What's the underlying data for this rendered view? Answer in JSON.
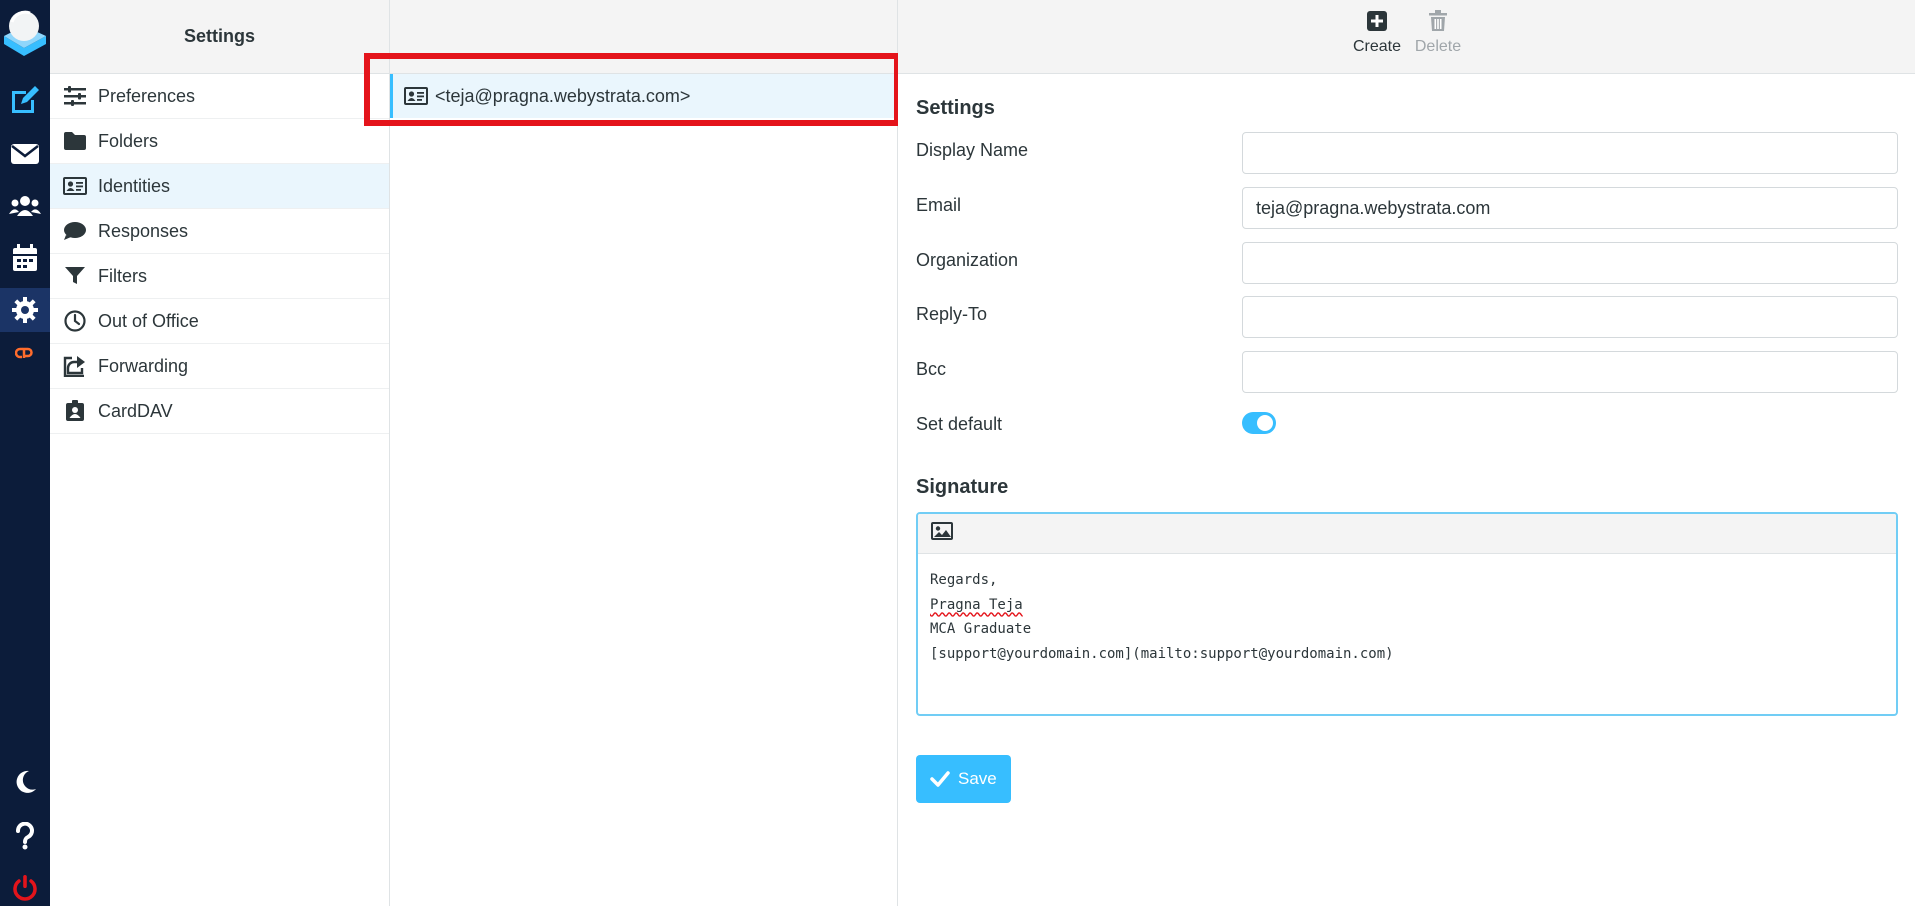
{
  "nav": {
    "title": "Settings",
    "items": [
      {
        "label": "Preferences",
        "icon": "sliders-icon"
      },
      {
        "label": "Folders",
        "icon": "folder-icon"
      },
      {
        "label": "Identities",
        "icon": "id-card-icon"
      },
      {
        "label": "Responses",
        "icon": "comment-icon"
      },
      {
        "label": "Filters",
        "icon": "filter-icon"
      },
      {
        "label": "Out of Office",
        "icon": "clock-icon"
      },
      {
        "label": "Forwarding",
        "icon": "share-icon"
      },
      {
        "label": "CardDAV",
        "icon": "address-book-icon"
      }
    ]
  },
  "rail": {
    "items": [
      "compose-icon",
      "mail-icon",
      "contacts-icon",
      "calendar-icon",
      "settings-icon",
      "cpanel-icon",
      "dark-mode-icon",
      "help-icon",
      "logout-icon"
    ],
    "accent": "#37beff",
    "logout_color": "#e4141b",
    "cpanel_color": "#ff6c2c"
  },
  "identities": {
    "selected": "<teja@pragna.webystrata.com>"
  },
  "toolbar": {
    "create_label": "Create",
    "delete_label": "Delete"
  },
  "form": {
    "settings_title": "Settings",
    "display_name": {
      "label": "Display Name",
      "value": ""
    },
    "email": {
      "label": "Email",
      "value": "teja@pragna.webystrata.com"
    },
    "organization": {
      "label": "Organization",
      "value": ""
    },
    "reply_to": {
      "label": "Reply-To",
      "value": ""
    },
    "bcc": {
      "label": "Bcc",
      "value": ""
    },
    "set_default": {
      "label": "Set default",
      "checked": true
    }
  },
  "signature": {
    "title": "Signature",
    "lines": [
      "Regards,",
      "Pragna Teja",
      "MCA Graduate",
      "[support@yourdomain.com](mailto:support@yourdomain.com)"
    ]
  },
  "save_label": "Save",
  "colors": {
    "highlight": "#e4141b",
    "selection": "#eaf6fd",
    "rail_bg": "#0c1c3a"
  }
}
